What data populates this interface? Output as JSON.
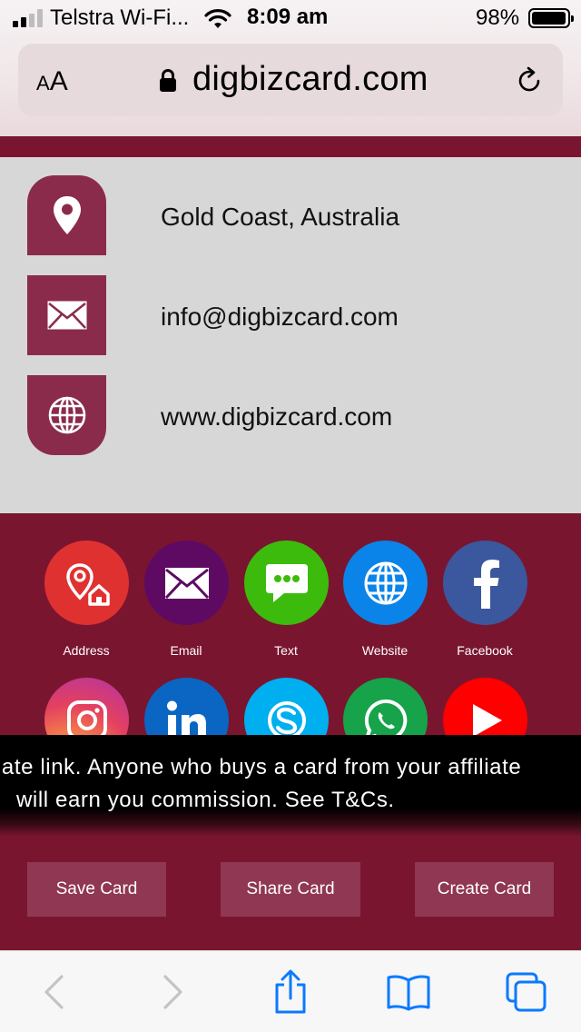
{
  "status_bar": {
    "carrier": "Telstra Wi-Fi...",
    "time": "8:09 am",
    "battery_percent": "98%",
    "battery_level": 0.98,
    "signal_bars_filled": 2
  },
  "address_bar": {
    "text_size_label_small": "A",
    "text_size_label_big": "A",
    "domain": "digbizcard.com"
  },
  "contact": {
    "items": [
      {
        "icon": "location-pin-icon",
        "text": "Gold Coast, Australia"
      },
      {
        "icon": "envelope-icon",
        "text": "info@digbizcard.com"
      },
      {
        "icon": "globe-icon",
        "text": "www.digbizcard.com"
      }
    ]
  },
  "social": {
    "buttons": [
      {
        "icon": "address-icon",
        "label": "Address",
        "color": "#e03131"
      },
      {
        "icon": "email-icon",
        "label": "Email",
        "color": "#5e0a63"
      },
      {
        "icon": "text-message-icon",
        "label": "Text",
        "color": "#3dbb0d"
      },
      {
        "icon": "website-icon",
        "label": "Website",
        "color": "#0a84e8"
      },
      {
        "icon": "facebook-icon",
        "label": "Facebook",
        "color": "#3b579d"
      },
      {
        "icon": "instagram-icon",
        "label": "",
        "color": "#e4405f"
      },
      {
        "icon": "linkedin-icon",
        "label": "",
        "color": "#0a66c2"
      },
      {
        "icon": "skype-icon",
        "label": "",
        "color": "#00aff0"
      },
      {
        "icon": "whatsapp-icon",
        "label": "",
        "color": "#16a34a"
      },
      {
        "icon": "youtube-icon",
        "label": "",
        "color": "#ff0000"
      }
    ]
  },
  "banner": {
    "line1": "iate link. Anyone who buys a card from your affiliate",
    "line2": "will earn you commission. See T&Cs."
  },
  "actions": {
    "save": "Save Card",
    "share": "Share Card",
    "create": "Create Card"
  },
  "toolbar": {
    "icons": [
      "back-icon",
      "forward-icon",
      "share-icon",
      "bookmarks-icon",
      "tabs-icon"
    ]
  },
  "colors": {
    "brand": "#7a1530",
    "tile": "#8b2b4b",
    "button": "#8f3753",
    "contact_bg": "#d7d7d7",
    "safari_blue": "#0a7aff"
  }
}
